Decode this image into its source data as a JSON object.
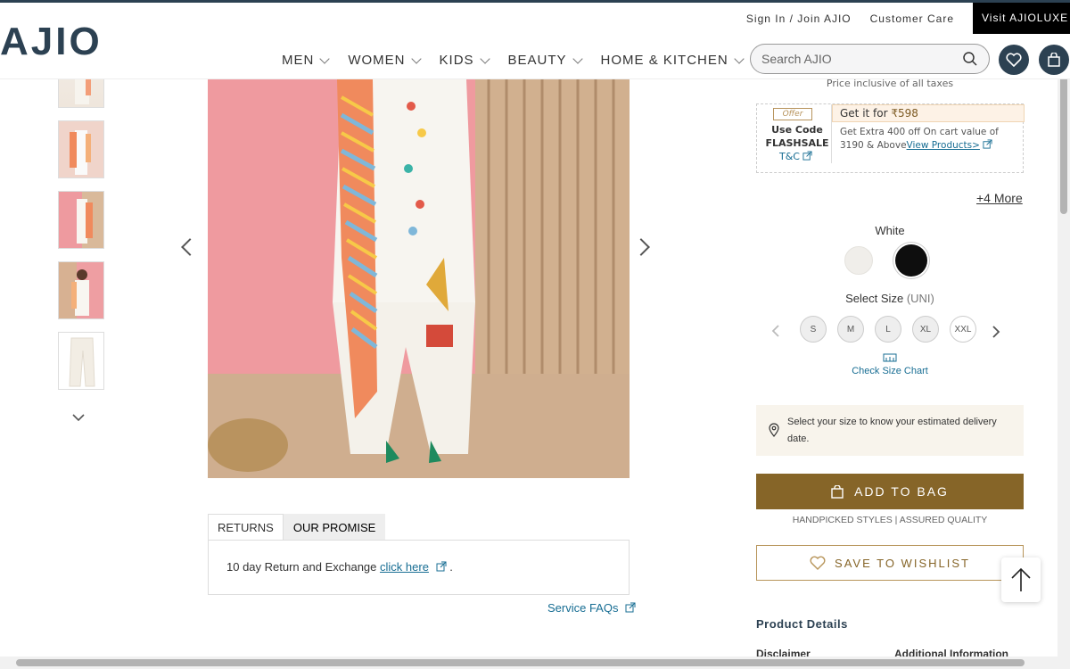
{
  "header": {
    "logo": "AJIO",
    "utility": {
      "signin": "Sign In / Join AJIO",
      "customer_care": "Customer Care",
      "luxe": "Visit AJIOLUXE"
    },
    "nav": [
      "MEN",
      "WOMEN",
      "KIDS",
      "BEAUTY",
      "HOME & KITCHEN"
    ],
    "search_placeholder": "Search AJIO"
  },
  "gallery": {
    "thumbnails": [
      "thumbnail-1",
      "thumbnail-2",
      "thumbnail-3",
      "thumbnail-4",
      "thumbnail-5"
    ],
    "colors": {
      "pink": "#ef9a9f",
      "wood": "#c9a98a",
      "ivory": "#f2ede4",
      "dupatta_orange": "#f08a5d"
    }
  },
  "tabs": {
    "returns": "RETURNS",
    "promise": "OUR PROMISE"
  },
  "returns_panel": {
    "text": "10 day Return and Exchange ",
    "link": "click here",
    "end": "."
  },
  "service_faqs": "Service FAQs",
  "pricing": {
    "taxes": "Price inclusive of all taxes"
  },
  "offer": {
    "tag": "Offer",
    "use_code": "Use Code",
    "code": "FLASHSALE",
    "tc": "T&C",
    "get_it_for": "Get it for ",
    "price": "₹598",
    "description": "Get Extra 400 off On cart value of 3190 & Above",
    "view_products": "View Products>"
  },
  "more_offers": "+4 More",
  "color": {
    "name": "White",
    "swatches": [
      "#f0eeea",
      "#0e0e0e"
    ]
  },
  "size": {
    "label": "Select Size",
    "unit": "(UNI)",
    "options": [
      "S",
      "M",
      "L",
      "XL",
      "XXL"
    ],
    "size_chart": "Check Size Chart"
  },
  "delivery": "Select your size to know your estimated delivery date.",
  "actions": {
    "add_to_bag": "ADD TO BAG",
    "handpicked": "HANDPICKED STYLES | ASSURED QUALITY",
    "wishlist": "SAVE TO WISHLIST"
  },
  "details": {
    "title": "Product Details",
    "disclaimer": "Disclaimer",
    "additional": "Additional Information"
  },
  "brand_colors": {
    "navy": "#2c4152",
    "gold": "#866528",
    "link": "#176d93"
  }
}
